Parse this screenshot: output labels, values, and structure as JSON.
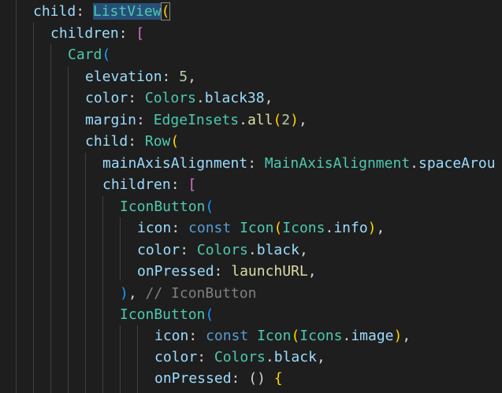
{
  "code_lines": [
    [
      {
        "t": "child",
        "c": "prop"
      },
      {
        "t": ": ",
        "c": "punc"
      },
      {
        "t": "ListView",
        "c": "class",
        "hl": true
      },
      {
        "t": "(",
        "c": "bracket",
        "box": true
      }
    ],
    [
      {
        "t": "children",
        "c": "prop"
      },
      {
        "t": ": ",
        "c": "punc"
      },
      {
        "t": "[",
        "c": "bracket2"
      }
    ],
    [
      {
        "t": "Card",
        "c": "class"
      },
      {
        "t": "(",
        "c": "bracket3"
      }
    ],
    [
      {
        "t": "elevation",
        "c": "prop"
      },
      {
        "t": ": ",
        "c": "punc"
      },
      {
        "t": "5",
        "c": "num"
      },
      {
        "t": ",",
        "c": "punc"
      }
    ],
    [
      {
        "t": "color",
        "c": "prop"
      },
      {
        "t": ": ",
        "c": "punc"
      },
      {
        "t": "Colors",
        "c": "class"
      },
      {
        "t": ".",
        "c": "punc"
      },
      {
        "t": "black38",
        "c": "prop"
      },
      {
        "t": ",",
        "c": "punc"
      }
    ],
    [
      {
        "t": "margin",
        "c": "prop"
      },
      {
        "t": ": ",
        "c": "punc"
      },
      {
        "t": "EdgeInsets",
        "c": "class"
      },
      {
        "t": ".",
        "c": "punc"
      },
      {
        "t": "all",
        "c": "fn"
      },
      {
        "t": "(",
        "c": "bracket"
      },
      {
        "t": "2",
        "c": "num"
      },
      {
        "t": ")",
        "c": "bracket"
      },
      {
        "t": ",",
        "c": "punc"
      }
    ],
    [
      {
        "t": "child",
        "c": "prop"
      },
      {
        "t": ": ",
        "c": "punc"
      },
      {
        "t": "Row",
        "c": "class"
      },
      {
        "t": "(",
        "c": "bracket"
      }
    ],
    [
      {
        "t": "mainAxisAlignment",
        "c": "prop"
      },
      {
        "t": ": ",
        "c": "punc"
      },
      {
        "t": "MainAxisAlignment",
        "c": "class"
      },
      {
        "t": ".",
        "c": "punc"
      },
      {
        "t": "spaceArou",
        "c": "prop"
      }
    ],
    [
      {
        "t": "children",
        "c": "prop"
      },
      {
        "t": ": ",
        "c": "punc"
      },
      {
        "t": "[",
        "c": "bracket2"
      }
    ],
    [
      {
        "t": "IconButton",
        "c": "class"
      },
      {
        "t": "(",
        "c": "bracket3"
      }
    ],
    [
      {
        "t": "icon",
        "c": "prop"
      },
      {
        "t": ": ",
        "c": "punc"
      },
      {
        "t": "const",
        "c": "kw"
      },
      {
        "t": " ",
        "c": "punc"
      },
      {
        "t": "Icon",
        "c": "class"
      },
      {
        "t": "(",
        "c": "bracket"
      },
      {
        "t": "Icons",
        "c": "class"
      },
      {
        "t": ".",
        "c": "punc"
      },
      {
        "t": "info",
        "c": "prop"
      },
      {
        "t": ")",
        "c": "bracket"
      },
      {
        "t": ",",
        "c": "punc"
      }
    ],
    [
      {
        "t": "color",
        "c": "prop"
      },
      {
        "t": ": ",
        "c": "punc"
      },
      {
        "t": "Colors",
        "c": "class"
      },
      {
        "t": ".",
        "c": "punc"
      },
      {
        "t": "black",
        "c": "prop"
      },
      {
        "t": ",",
        "c": "punc"
      }
    ],
    [
      {
        "t": "onPressed",
        "c": "prop"
      },
      {
        "t": ": ",
        "c": "punc"
      },
      {
        "t": "launchURL",
        "c": "fn"
      },
      {
        "t": ",",
        "c": "punc"
      }
    ],
    [
      {
        "t": ")",
        "c": "bracket3"
      },
      {
        "t": ", ",
        "c": "punc"
      },
      {
        "t": "// IconButton",
        "c": "comment"
      }
    ],
    [
      {
        "t": "IconButton",
        "c": "class"
      },
      {
        "t": "(",
        "c": "bracket3"
      }
    ],
    [
      {
        "t": "icon",
        "c": "prop"
      },
      {
        "t": ": ",
        "c": "punc"
      },
      {
        "t": "const",
        "c": "kw"
      },
      {
        "t": " ",
        "c": "punc"
      },
      {
        "t": "Icon",
        "c": "class"
      },
      {
        "t": "(",
        "c": "bracket"
      },
      {
        "t": "Icons",
        "c": "class"
      },
      {
        "t": ".",
        "c": "punc"
      },
      {
        "t": "image",
        "c": "prop"
      },
      {
        "t": ")",
        "c": "bracket"
      },
      {
        "t": ",",
        "c": "punc"
      }
    ],
    [
      {
        "t": "color",
        "c": "prop"
      },
      {
        "t": ": ",
        "c": "punc"
      },
      {
        "t": "Colors",
        "c": "class"
      },
      {
        "t": ".",
        "c": "punc"
      },
      {
        "t": "black",
        "c": "prop"
      },
      {
        "t": ",",
        "c": "punc"
      }
    ],
    [
      {
        "t": "onPressed",
        "c": "prop"
      },
      {
        "t": ": ",
        "c": "punc"
      },
      {
        "t": "() ",
        "c": "punc"
      },
      {
        "t": "{",
        "c": "bracket"
      }
    ]
  ]
}
